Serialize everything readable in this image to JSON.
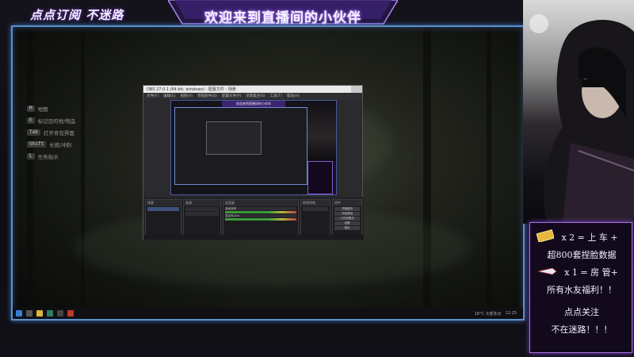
{
  "overlay": {
    "top_left": "点点订阅 不迷路",
    "banner_title": "欢迎来到直播间的小伙伴"
  },
  "hints": [
    {
      "key": "M",
      "label": "地图"
    },
    {
      "key": "E",
      "label": "标记目的地/物品"
    },
    {
      "key": "Tab",
      "label": "打开背包界面"
    },
    {
      "key": "Shift",
      "label": "长按/冲刺"
    },
    {
      "key": "L",
      "label": "任务指示"
    }
  ],
  "obs": {
    "title": "OBS 27.0.1 (64-bit, windows) - 配置文件 - 场景",
    "menu": [
      "文件(F)",
      "编辑(E)",
      "视图(V)",
      "停靠部件(D)",
      "配置文件(P)",
      "场景集合(S)",
      "工具(T)",
      "帮助(H)"
    ],
    "mini_banner": "欢迎来到直播间的小伙伴",
    "docks": {
      "scenes": "场景",
      "sources": "来源",
      "mixer": "混音器",
      "transitions": "转场特效",
      "controls": "控件"
    },
    "mixer_tracks": [
      "桌面音频",
      "麦克风/Aux"
    ],
    "control_buttons": [
      "开始推流",
      "开始录制",
      "工作室模式",
      "设置",
      "退出"
    ]
  },
  "taskbar": {
    "weather": "18°C 大部多云",
    "time": "12:25"
  },
  "info_card": {
    "line1": "x 2 = 上 车 +",
    "line2": "超800套捏脸数据",
    "line3": "x 1 = 房 管+",
    "line4": "所有水友福利！！",
    "line5": "点点关注",
    "line6": "不在迷路！！！"
  },
  "colors": {
    "frame_blue": "#5c8fc8",
    "accent_purple": "#a56fe6",
    "card_bg": "#120a1c"
  }
}
